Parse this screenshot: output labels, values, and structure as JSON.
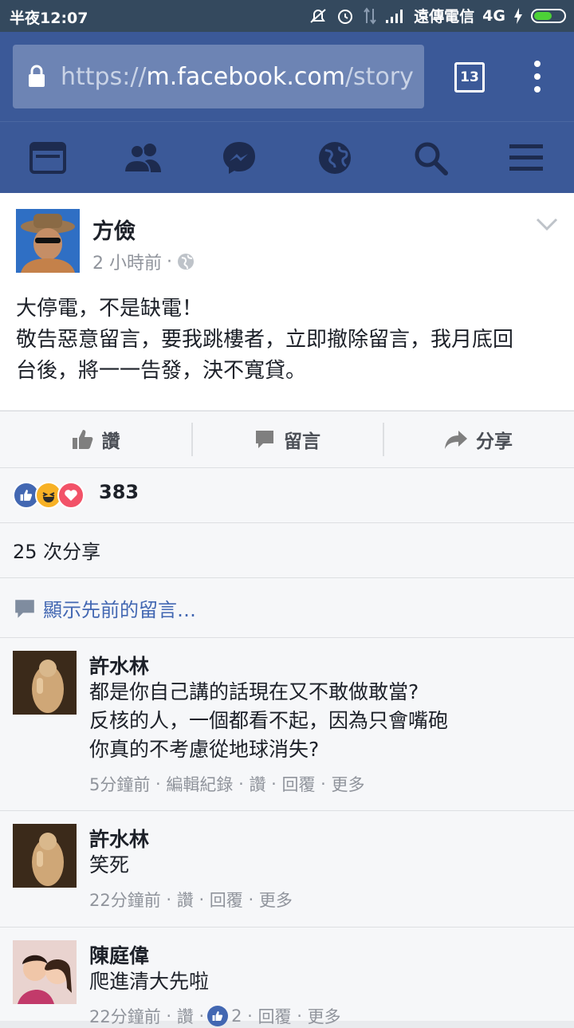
{
  "status_bar": {
    "time": "半夜12:07",
    "carrier": "遠傳電信",
    "network": "4G"
  },
  "browser": {
    "url_scheme": "https://",
    "url_host": "m.facebook.com",
    "url_path": "/story",
    "tab_count": "13"
  },
  "nav": {
    "icons": [
      "news-feed-icon",
      "friends-icon",
      "messenger-icon",
      "globe-notifications-icon",
      "search-icon",
      "menu-icon"
    ]
  },
  "post": {
    "author": "方儉",
    "time": "2 小時前",
    "separator": "·",
    "lines": [
      "大停電，不是缺電！",
      "敬告惡意留言，要我跳樓者，立即撤除留言，我月底回",
      "台後，將一一告發，決不寬貸。"
    ]
  },
  "actions": {
    "like": "讚",
    "comment": "留言",
    "share": "分享"
  },
  "stats": {
    "reaction_count": "383",
    "shares": "25 次分享",
    "show_previous": "顯示先前的留言…"
  },
  "comments": [
    {
      "name": "許水林",
      "lines": [
        "都是你自己講的話現在又不敢做敢當?",
        "反核的人，一個都看不起，因為只會嘴砲",
        "你真的不考慮從地球消失?"
      ],
      "time": "5分鐘前",
      "edit": "編輯紀錄",
      "like": "讚",
      "reply": "回覆",
      "more": "更多"
    },
    {
      "name": "許水林",
      "lines": [
        "笑死"
      ],
      "time": "22分鐘前",
      "like": "讚",
      "reply": "回覆",
      "more": "更多"
    },
    {
      "name": "陳庭偉",
      "lines": [
        "爬進清大先啦"
      ],
      "time": "22分鐘前",
      "like": "讚",
      "like_count": "2",
      "reply": "回覆",
      "more": "更多"
    }
  ],
  "colors": {
    "facebook_blue": "#3b5998",
    "link_blue": "#4267b2",
    "meta_gray": "#90949c"
  }
}
